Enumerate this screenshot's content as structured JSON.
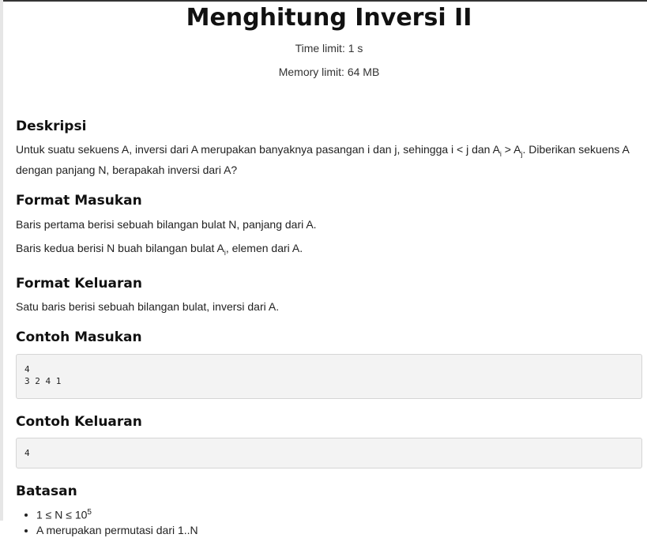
{
  "problem": {
    "title": "Menghitung Inversi II",
    "time_limit": "Time limit: 1 s",
    "memory_limit": "Memory limit: 64 MB"
  },
  "deskripsi": {
    "heading": "Deskripsi",
    "text_a": "Untuk suatu sekuens A, inversi dari A merupakan banyaknya pasangan i dan j, sehingga i < j dan A",
    "sub_i": "i",
    "text_b": " > A",
    "sub_j": "j",
    "text_c": ". Diberikan sekuens A dengan panjang N, berapakah inversi dari A?"
  },
  "format_masukan": {
    "heading": "Format Masukan",
    "line1": "Baris pertama berisi sebuah bilangan bulat N, panjang dari A.",
    "line2_a": "Baris kedua berisi N buah bilangan bulat A",
    "line2_sub": "i",
    "line2_b": ", elemen dari A."
  },
  "format_keluaran": {
    "heading": "Format Keluaran",
    "line1": "Satu baris berisi sebuah bilangan bulat, inversi dari A."
  },
  "contoh_masukan": {
    "heading": "Contoh Masukan",
    "content": "4\n3 2 4 1"
  },
  "contoh_keluaran": {
    "heading": "Contoh Keluaran",
    "content": "4"
  },
  "batasan": {
    "heading": "Batasan",
    "item1_a": "1 ≤ N ≤ 10",
    "item1_sup": "5",
    "item2": "A merupakan permutasi dari 1..N"
  }
}
